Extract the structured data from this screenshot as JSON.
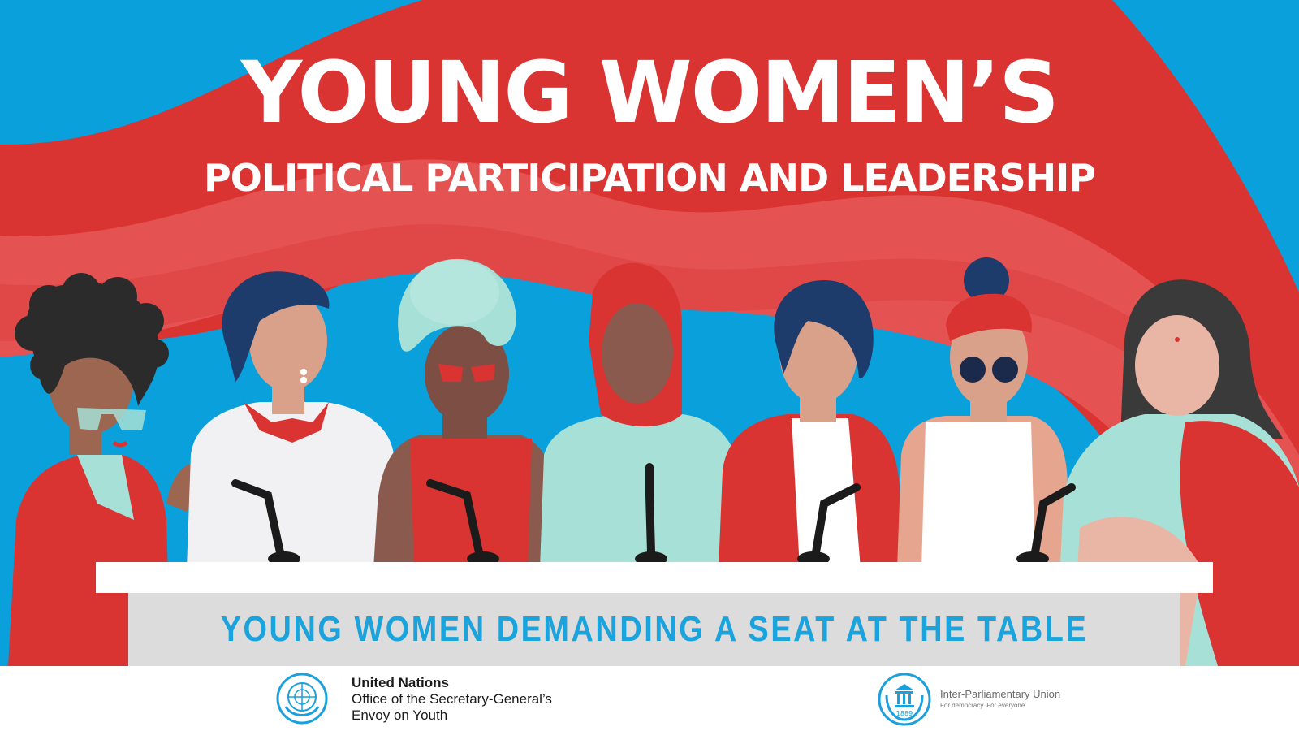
{
  "title": {
    "main": "YOUNG WOMEN’S",
    "subtitle": "POLITICAL PARTICIPATION AND LEADERSHIP"
  },
  "banner": {
    "text": "YOUNG WOMEN DEMANDING A SEAT AT THE TABLE"
  },
  "footer": {
    "un": {
      "line1": "United Nations",
      "line2": "Office of the Secretary-General’s",
      "line3": "Envoy on Youth"
    },
    "ipu": {
      "name": "Inter-Parliamentary Union",
      "tagline": "For democracy. For everyone.",
      "year": "1889"
    }
  },
  "colors": {
    "sky": "#0aa0dc",
    "ribbon": "#d93332",
    "ribbon_light": "#e55252",
    "banner_bg": "#dcdcdc",
    "banner_text": "#1aa3dc",
    "un_blue": "#1aa0dc",
    "ipu_blue": "#1aa0dc"
  },
  "people": [
    "woman-curly-hair",
    "woman-short-hair",
    "woman-turban",
    "woman-hijab",
    "woman-bob-hair",
    "woman-headscarf-sunglasses",
    "woman-long-hair-sari"
  ],
  "icons": [
    "un-emblem-icon",
    "ipu-emblem-icon",
    "microphone-icon"
  ]
}
